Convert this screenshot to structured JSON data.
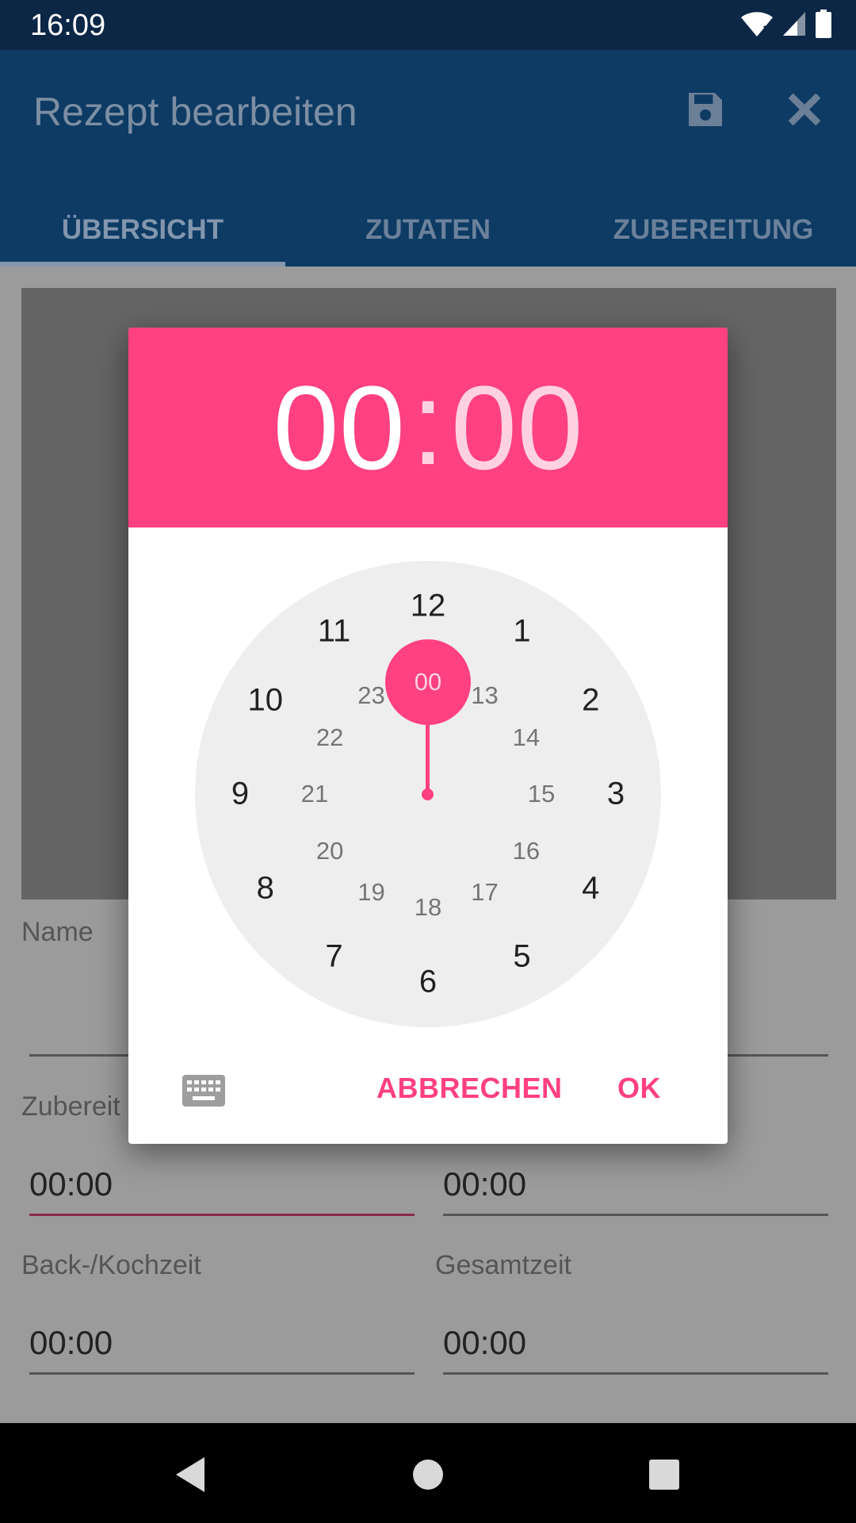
{
  "status_bar": {
    "time": "16:09",
    "icons": [
      "wifi-icon",
      "cellular-signal-icon",
      "battery-icon"
    ]
  },
  "app_bar": {
    "title": "Rezept bearbeiten",
    "actions": [
      "save-icon",
      "close-icon"
    ],
    "tabs": [
      {
        "label": "ÜBERSICHT",
        "active": true
      },
      {
        "label": "ZUTATEN",
        "active": false
      },
      {
        "label": "ZUBEREITUNG",
        "active": false
      }
    ]
  },
  "form": {
    "name_label": "Name",
    "prep_label": "Zubereit",
    "prep_value": "00:00",
    "right_top_value": "00:00",
    "bake_label": "Back-/Kochzeit",
    "bake_value": "00:00",
    "total_label": "Gesamtzeit",
    "total_value": "00:00"
  },
  "time_picker": {
    "hours": "00",
    "separator": ":",
    "minutes": "00",
    "selected": "00",
    "outer_numbers": [
      "12",
      "1",
      "2",
      "3",
      "4",
      "5",
      "6",
      "7",
      "8",
      "9",
      "10",
      "11"
    ],
    "inner_numbers": [
      "13",
      "14",
      "15",
      "16",
      "17",
      "18",
      "19",
      "20",
      "21",
      "22",
      "23"
    ],
    "cancel_label": "ABBRECHEN",
    "ok_label": "OK",
    "keyboard_icon": "keyboard-icon",
    "accent_color": "#ff4081"
  },
  "nav_bar": {
    "icons": [
      "back-icon",
      "home-icon",
      "recents-icon"
    ]
  }
}
